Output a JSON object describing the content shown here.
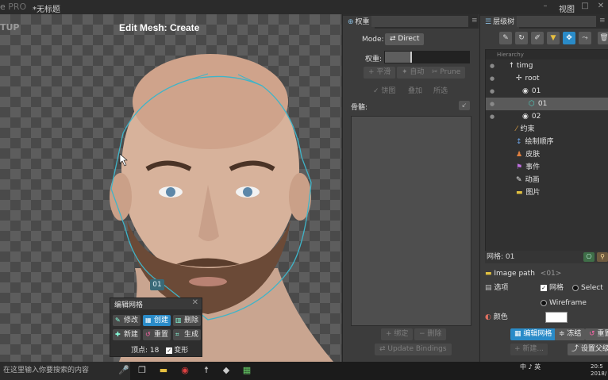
{
  "titlebar": {
    "brand_tail": "e",
    "brand_pro": "PRO",
    "document": "*无标题",
    "view_menu": "视图",
    "controls": {
      "minimize": "–",
      "maximize": "□",
      "close": "✕"
    }
  },
  "viewport": {
    "setup_label": "TUP",
    "mode_title": "Edit Mesh: Create",
    "node_badge": "01"
  },
  "edit_mesh_panel": {
    "title": "编辑网格",
    "close": "✕",
    "buttons": {
      "modify": "修改",
      "create": "创建",
      "delete": "删除",
      "new": "新建",
      "reset": "重置",
      "generate": "生成"
    },
    "vertices_label": "顶点: 18",
    "deform_label": "变形",
    "deform_checked": true
  },
  "weights_panel": {
    "tab": "权重",
    "menu": "≡",
    "mode_label": "Mode:",
    "mode_value": "Direct",
    "weight_label": "权重:",
    "weight_fraction": 0.3,
    "smooth": "平滑",
    "auto": "自动",
    "prune": "Prune",
    "pie": "饼图",
    "overlay": "叠加",
    "selected": "所选",
    "bones_label": "骨骼:",
    "bind": "绑定",
    "remove": "删除",
    "update_bindings": "Update Bindings"
  },
  "hierarchy_panel": {
    "tab": "层级树",
    "menu": "≡",
    "tree_header": "Hierarchy",
    "nodes": [
      {
        "label": "timg"
      },
      {
        "label": "root"
      },
      {
        "label": "01"
      },
      {
        "label": "01"
      },
      {
        "label": "02"
      },
      {
        "label": "约束"
      },
      {
        "label": "绘制顺序"
      },
      {
        "label": "皮肤"
      },
      {
        "label": "事件"
      },
      {
        "label": "动画"
      },
      {
        "label": "图片"
      }
    ],
    "mesh_name": "网格: 01",
    "image_path_label": "Image path",
    "image_path_value": "<01>",
    "options_label": "选项",
    "mesh_option": "网格",
    "select_option": "Select",
    "wireframe_option": "Wireframe",
    "color_label": "颜色",
    "color_value": "#ffffff",
    "edit_mesh_button": "编辑网格",
    "freeze_button": "冻结",
    "reset_button": "重置",
    "new_button": "新建...",
    "set_parent_button": "设置父级"
  },
  "taskbar": {
    "search_placeholder": "在这里输入你要搜索的内容",
    "tray_text": "中 ♪ 英",
    "time": "20:5",
    "date": "2018/"
  },
  "colors": {
    "accent": "#2a8bc8",
    "panel": "#3c3c3c",
    "dark": "#2b2b2b"
  }
}
